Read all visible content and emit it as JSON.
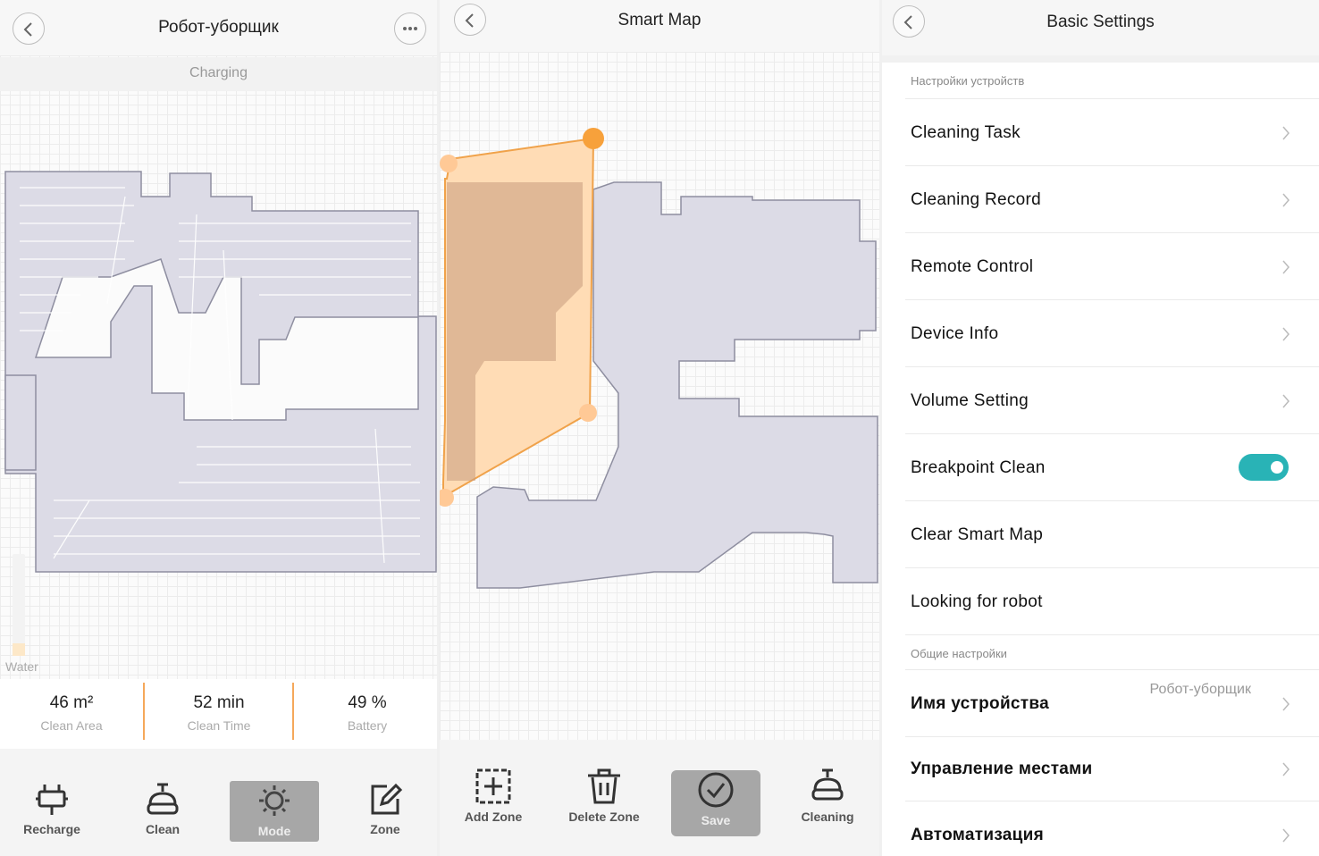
{
  "panel1": {
    "title": "Робот-уборщик",
    "status": "Charging",
    "water_label": "Water",
    "water_level_percent": 12,
    "stats": [
      {
        "value": "46  m²",
        "label": "Clean Area"
      },
      {
        "value": "52  min",
        "label": "Clean Time"
      },
      {
        "value": "49  %",
        "label": "Battery"
      }
    ],
    "toolbar": [
      {
        "label": "Recharge",
        "icon": "plug-icon",
        "active": false
      },
      {
        "label": "Clean",
        "icon": "robot-icon",
        "active": false
      },
      {
        "label": "Mode",
        "icon": "sun-gear-icon",
        "active": true
      },
      {
        "label": "Zone",
        "icon": "edit-icon",
        "active": false
      }
    ]
  },
  "panel2": {
    "title": "Smart Map",
    "toolbar": [
      {
        "label": "Add Zone",
        "icon": "add-zone-icon",
        "active": false
      },
      {
        "label": "Delete Zone",
        "icon": "trash-icon",
        "active": false
      },
      {
        "label": "Save",
        "icon": "check-circle-icon",
        "active": true
      },
      {
        "label": "Cleaning",
        "icon": "robot-icon",
        "active": false
      }
    ]
  },
  "panel3": {
    "title": "Basic Settings",
    "section1": "Настройки устройств",
    "section2": "Общие настройки",
    "items": [
      {
        "label": "Cleaning Task"
      },
      {
        "label": "Cleaning Record"
      },
      {
        "label": "Remote Control"
      },
      {
        "label": "Device Info"
      },
      {
        "label": "Volume Setting"
      },
      {
        "label": "Breakpoint Clean",
        "toggle": true
      },
      {
        "label": "Clear Smart Map"
      },
      {
        "label": "Looking for robot"
      }
    ],
    "items2": [
      {
        "label": "Имя устройства",
        "value": "Робот-уборщик"
      },
      {
        "label": "Управление местами"
      },
      {
        "label": "Автоматизация"
      }
    ]
  },
  "colors": {
    "accent_orange": "#f5a85a",
    "zone_fill": "#ffdcb5",
    "map_fill": "#dcdbe6",
    "toggle_on": "#29b3b6"
  }
}
